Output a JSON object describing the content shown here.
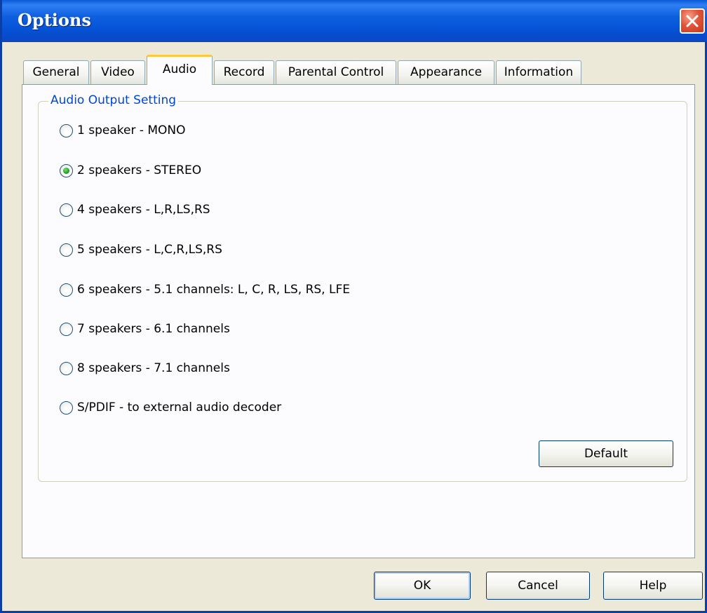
{
  "window": {
    "title": "Options"
  },
  "tabs": [
    {
      "label": "General"
    },
    {
      "label": "Video"
    },
    {
      "label": "Audio"
    },
    {
      "label": "Record"
    },
    {
      "label": "Parental Control"
    },
    {
      "label": "Appearance"
    },
    {
      "label": "Information"
    }
  ],
  "active_tab": "Audio",
  "group": {
    "legend": "Audio Output Setting"
  },
  "options": [
    {
      "label": "1 speaker - MONO",
      "checked": false
    },
    {
      "label": "2 speakers - STEREO",
      "checked": true
    },
    {
      "label": "4 speakers - L,R,LS,RS",
      "checked": false
    },
    {
      "label": "5 speakers - L,C,R,LS,RS",
      "checked": false
    },
    {
      "label": "6 speakers - 5.1 channels: L, C, R, LS, RS, LFE",
      "checked": false
    },
    {
      "label": "7 speakers - 6.1 channels",
      "checked": false
    },
    {
      "label": "8 speakers - 7.1 channels",
      "checked": false
    },
    {
      "label": "S/PDIF - to external audio decoder",
      "checked": false
    }
  ],
  "buttons": {
    "default_label": "Default",
    "ok_label": "OK",
    "cancel_label": "Cancel",
    "help_label": "Help"
  },
  "colors": {
    "title_bar": "#0552d6",
    "legend_text": "#0046d5",
    "active_tab_accent": "#ffc83c",
    "close_button": "#e0553a"
  }
}
